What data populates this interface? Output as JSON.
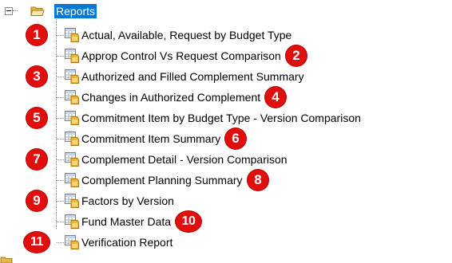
{
  "tree": {
    "root": {
      "label": "Reports",
      "icon": "open-folder-icon",
      "expanded": true
    },
    "items": [
      {
        "label": "Actual, Available, Request by Budget Type",
        "badge": "1",
        "icon": "report-icon"
      },
      {
        "label": "Approp Control Vs Request Comparison",
        "badge": "2",
        "icon": "report-icon"
      },
      {
        "label": "Authorized and Filled Complement Summary",
        "badge": "3",
        "icon": "report-icon"
      },
      {
        "label": "Changes in Authorized Complement",
        "badge": "4",
        "icon": "report-icon"
      },
      {
        "label": "Commitment Item by Budget Type - Version Comparison",
        "badge": "5",
        "icon": "report-icon"
      },
      {
        "label": "Commitment Item Summary",
        "badge": "6",
        "icon": "report-icon"
      },
      {
        "label": "Complement Detail - Version Comparison",
        "badge": "7",
        "icon": "report-icon"
      },
      {
        "label": "Complement Planning Summary",
        "badge": "8",
        "icon": "report-icon"
      },
      {
        "label": "Factors by Version",
        "badge": "9",
        "icon": "report-icon"
      },
      {
        "label": "Fund Master Data",
        "badge": "10",
        "icon": "report-icon"
      },
      {
        "label": "Verification Report",
        "badge": "11",
        "icon": "report-icon"
      }
    ]
  },
  "colors": {
    "selection": "#0078d7",
    "badge": "#e10e0e",
    "folder": "#f2c94c"
  }
}
